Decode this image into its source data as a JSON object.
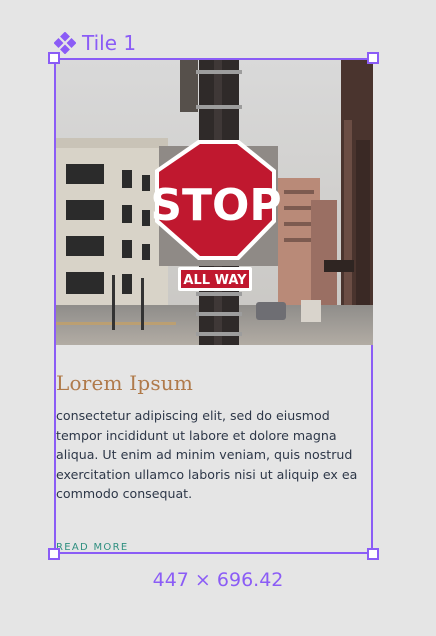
{
  "component": {
    "label": "Tile 1",
    "icon": "component-diamond-icon"
  },
  "card": {
    "image_alt": "Stop sign with all way plate on a city street",
    "sign_text": "STOP",
    "plate_text": "ALL WAY",
    "title": "Lorem Ipsum",
    "body": "consectetur adipiscing elit, sed do eiusmod tempor incididunt ut labore et dolore magna aliqua. Ut enim ad minim veniam, quis nostrud exercitation ullamco laboris nisi ut aliquip ex ea commodo consequat.",
    "read_more": "READ MORE"
  },
  "selection": {
    "dimensions": "447 × 696.42"
  },
  "colors": {
    "selection": "#8b5cf6",
    "title": "#b07a4a",
    "link": "#2f8f80",
    "sign": "#c0182f"
  }
}
